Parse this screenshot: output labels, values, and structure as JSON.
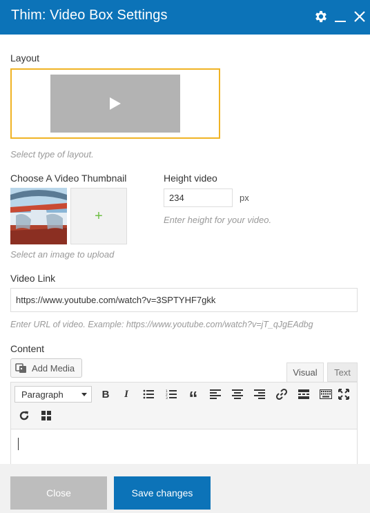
{
  "window": {
    "title": "Thim: Video Box Settings",
    "icons": [
      "gear-icon",
      "minimize-icon",
      "close-icon"
    ]
  },
  "layout": {
    "label": "Layout",
    "help": "Select type of layout.",
    "selected_border": "#f0b324"
  },
  "thumbnail": {
    "label": "Choose A Video Thumbnail",
    "help": "Select an image to upload",
    "add_glyph": "+"
  },
  "height": {
    "label": "Height video",
    "value": "234",
    "unit": "px",
    "help": "Enter height for your video."
  },
  "video_link": {
    "label": "Video Link",
    "value": "https://www.youtube.com/watch?v=3SPTYHF7gkk",
    "help": "Enter URL of video. Example: https://www.youtube.com/watch?v=jT_qJgEAdbg"
  },
  "content": {
    "label": "Content",
    "add_media": "Add Media",
    "tabs": [
      "Visual",
      "Text"
    ],
    "format_select": "Paragraph",
    "toolbar_icons": [
      "bold-icon",
      "italic-icon",
      "bullet-list-icon",
      "numbered-list-icon",
      "blockquote-icon",
      "align-left-icon",
      "align-center-icon",
      "align-right-icon",
      "link-icon",
      "read-more-icon",
      "keyboard-icon",
      "fullscreen-icon",
      "refresh-icon",
      "grid-icon"
    ]
  },
  "footer": {
    "close": "Close",
    "save": "Save changes"
  },
  "colors": {
    "brand": "#0c73b8",
    "accent": "#6fbf45"
  }
}
